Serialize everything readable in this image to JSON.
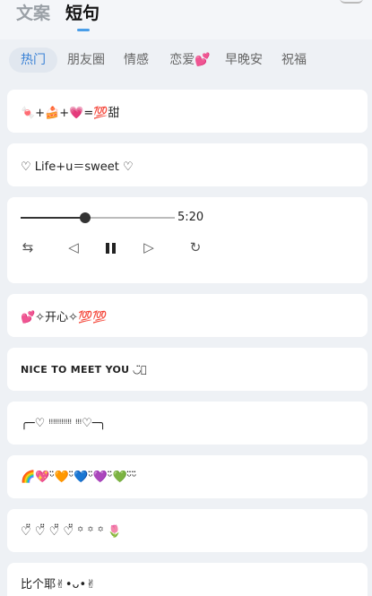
{
  "header": {
    "tabs": [
      {
        "label": "文案",
        "active": false
      },
      {
        "label": "短句",
        "active": true
      }
    ]
  },
  "categories": [
    "热门",
    "朋友圈",
    "情感",
    "恋爱💕",
    "早晚安",
    "祝福"
  ],
  "cards": [
    {
      "text": "🍬+🍰+💗=💯甜"
    },
    {
      "text": "♡ Life+u＝sweet ♡"
    },
    {
      "text": "💕✧开心✧💯💯"
    },
    {
      "text": "NICE TO MEET YOU ◡̈⃝"
    },
    {
      "text": "╭─♡ ᵎᵎᵎᵎᵎᵎᵎᵎᵎᵎᵎ ᵎᵎᵎ♡─╮"
    },
    {
      "text": "🌈💖ᵕ̈🧡ᵕ̈💙ᵕ̈💜ᵕ̈💚ᵕ̈ᵕ̈"
    },
    {
      "text": "♡̆̈ ♡̆̈ ♡̆̈ ♡̆̈ ꙳ ꙳ ꙳ 🌷"
    },
    {
      "text": "比个耶✌︎•ᴗ•✌︎"
    }
  ],
  "player": {
    "duration": "5:20",
    "progress": 0.42,
    "controls": {
      "loop": "⇆",
      "prev": "◁",
      "next": "▷",
      "refresh": "↻"
    }
  }
}
